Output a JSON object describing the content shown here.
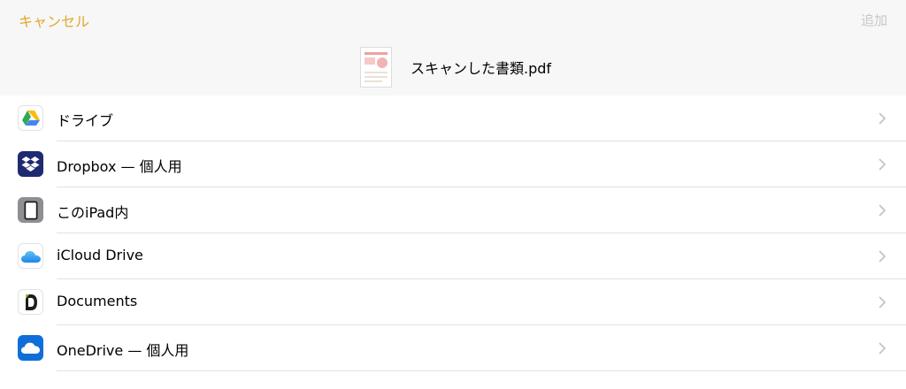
{
  "header": {
    "cancel_label": "キャンセル",
    "add_label": "追加",
    "document_name": "スキャンした書類.pdf"
  },
  "locations": [
    {
      "label": "ドライブ",
      "icon": "google-drive-icon"
    },
    {
      "label": "Dropbox — 個人用",
      "icon": "dropbox-icon"
    },
    {
      "label": "このiPad内",
      "icon": "ipad-icon"
    },
    {
      "label": "iCloud Drive",
      "icon": "icloud-icon"
    },
    {
      "label": "Documents",
      "icon": "documents-app-icon"
    },
    {
      "label": "OneDrive — 個人用",
      "icon": "onedrive-icon"
    }
  ],
  "colors": {
    "accent": "#e3a82b",
    "disabled": "#c8c8c8",
    "header_bg": "#f7f7f7",
    "separator": "#e1e1e1"
  }
}
